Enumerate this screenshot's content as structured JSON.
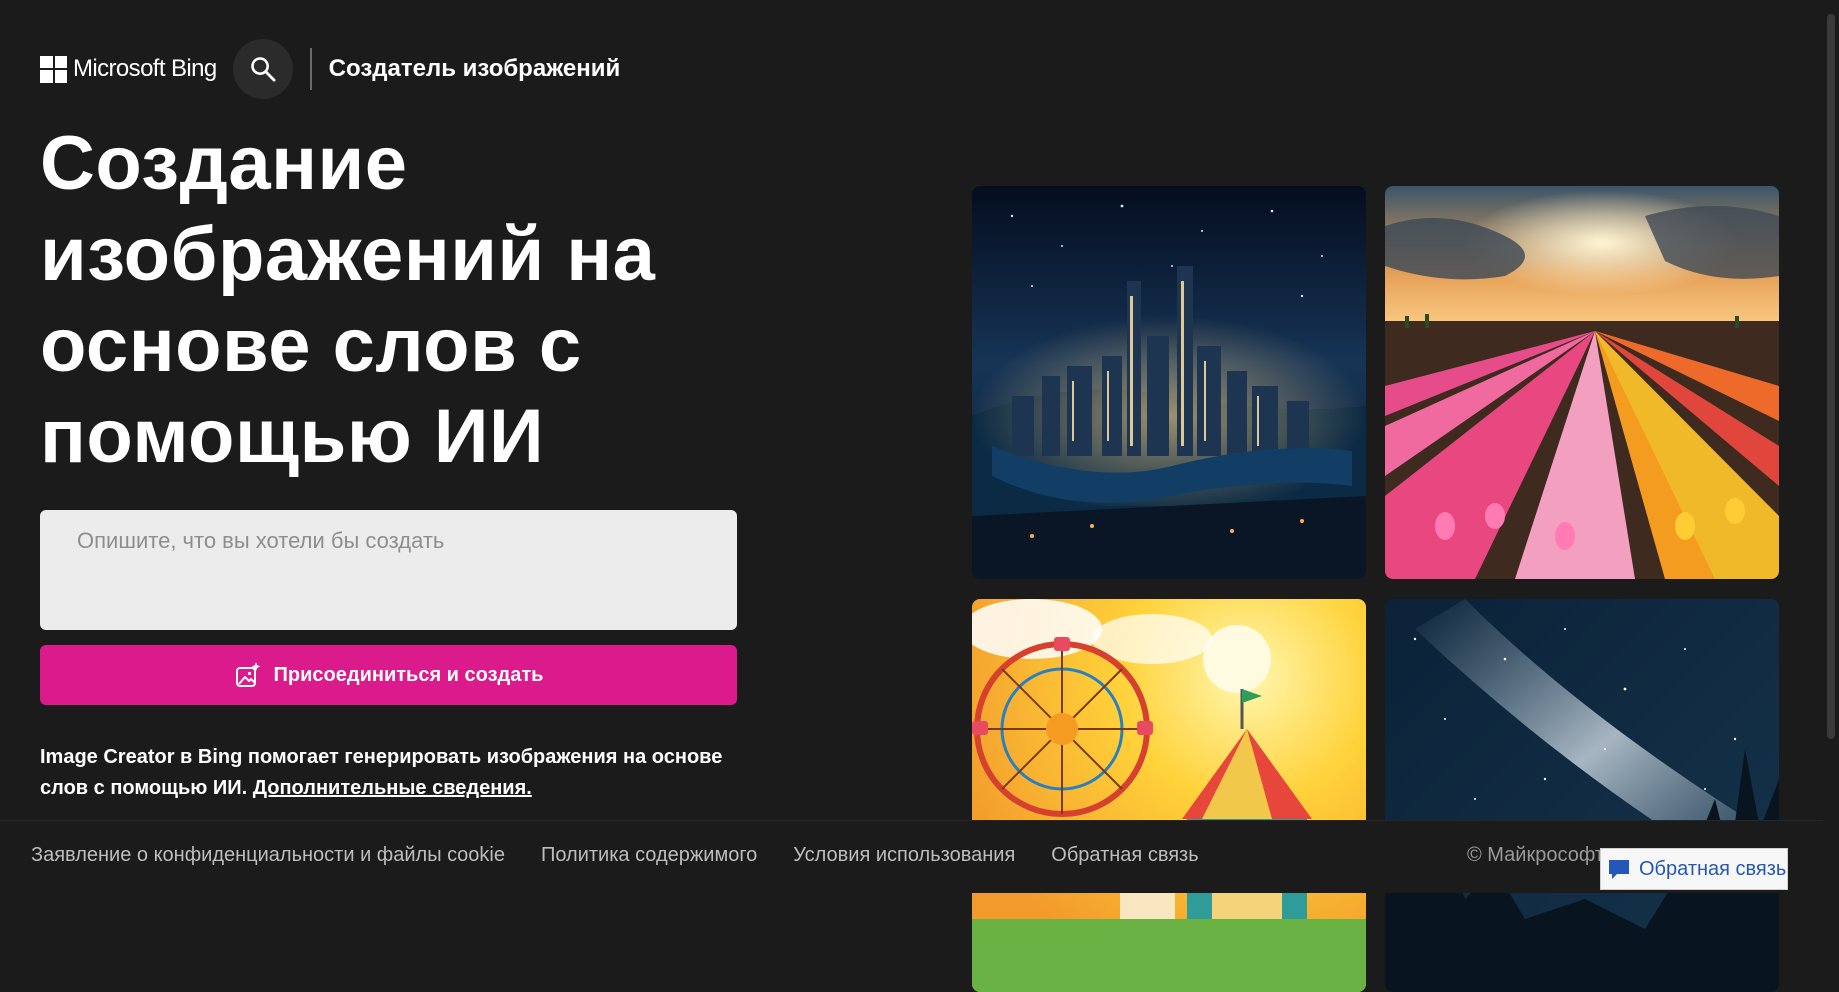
{
  "header": {
    "logo_text": "Microsoft Bing",
    "search_icon": "search-icon",
    "app_title": "Создатель изображений"
  },
  "hero": {
    "title": "Создание изображений на основе слов с помощью ИИ"
  },
  "prompt": {
    "placeholder": "Опишите, что вы хотели бы создать",
    "value": ""
  },
  "create_button": {
    "label": "Присоединиться и создать",
    "icon": "image-sparkle-icon",
    "color": "#db1b8b"
  },
  "description": {
    "text": "Image Creator в Bing помогает генерировать изображения на основе слов с помощью ИИ. ",
    "link": "Дополнительные сведения."
  },
  "gallery": {
    "images": [
      "city-night-image",
      "tulip-field-image",
      "carnival-image",
      "milky-way-image"
    ]
  },
  "footer": {
    "links": [
      "Заявление о конфиденциальности и файлы cookie",
      "Политика содержимого",
      "Условия использования",
      "Обратная связь"
    ],
    "copyright": "© Майкрософт"
  },
  "feedback_button": {
    "label": "Обратная связь",
    "icon": "chat-bubble-icon"
  }
}
